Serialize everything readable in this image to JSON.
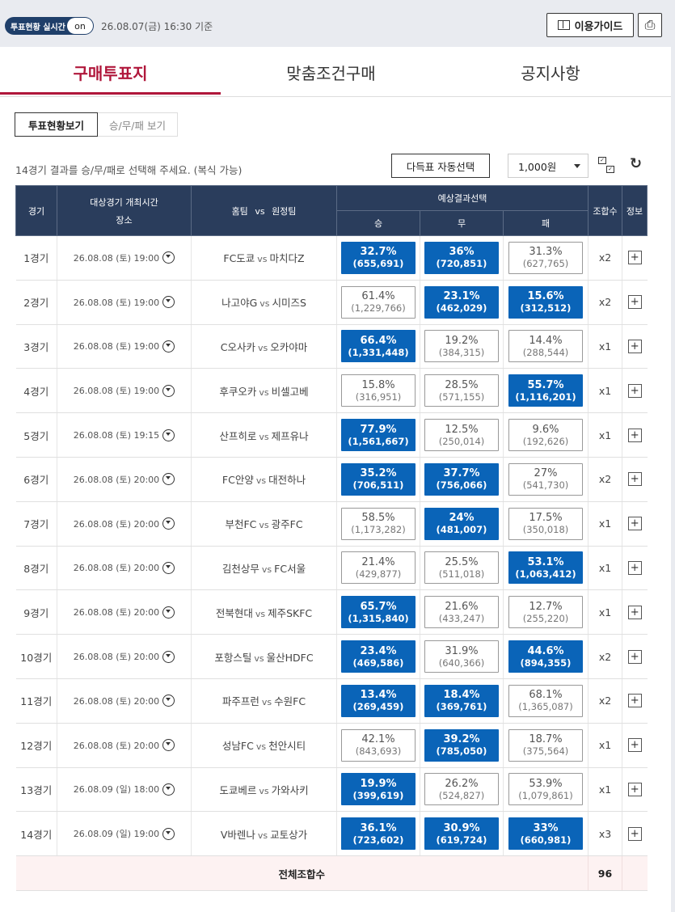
{
  "topbar": {
    "live_label": "투표현황 실시간",
    "live_toggle": "on",
    "timestamp": "26.08.07(금) 16:30 기준",
    "guide_label": "이용가이드"
  },
  "main_tabs": [
    {
      "label": "구매투표지",
      "active": true
    },
    {
      "label": "맞춤조건구매",
      "active": false
    },
    {
      "label": "공지사항",
      "active": false
    }
  ],
  "sub_tabs": [
    {
      "label": "투표현황보기",
      "active": true
    },
    {
      "label": "승/무/패 보기",
      "active": false
    }
  ],
  "toolbar": {
    "instruction": "14경기 결과를 승/무/패로 선택해 주세요. (복식 가능)",
    "auto_select_label": "다득표 자동선택",
    "amount_value": "1,000원"
  },
  "table": {
    "headers": {
      "game": "경기",
      "time_line1": "대상경기 개최시간",
      "time_line2": "장소",
      "teams_home": "홈팀",
      "teams_vs": "vs",
      "teams_away": "원정팀",
      "prediction": "예상결과선택",
      "win": "승",
      "draw": "무",
      "loss": "패",
      "combo": "조합수",
      "info": "정보"
    },
    "rows": [
      {
        "game": "1경기",
        "datetime": "26.08.08 (토) 19:00",
        "home": "FC도쿄",
        "away": "마치다Z",
        "win": {
          "pct": "32.7%",
          "count": "(655,691)",
          "selected": true
        },
        "draw": {
          "pct": "36%",
          "count": "(720,851)",
          "selected": true
        },
        "loss": {
          "pct": "31.3%",
          "count": "(627,765)",
          "selected": false
        },
        "combo": "x2"
      },
      {
        "game": "2경기",
        "datetime": "26.08.08 (토) 19:00",
        "home": "나고야G",
        "away": "시미즈S",
        "win": {
          "pct": "61.4%",
          "count": "(1,229,766)",
          "selected": false
        },
        "draw": {
          "pct": "23.1%",
          "count": "(462,029)",
          "selected": true
        },
        "loss": {
          "pct": "15.6%",
          "count": "(312,512)",
          "selected": true
        },
        "combo": "x2"
      },
      {
        "game": "3경기",
        "datetime": "26.08.08 (토) 19:00",
        "home": "C오사카",
        "away": "오카야마",
        "win": {
          "pct": "66.4%",
          "count": "(1,331,448)",
          "selected": true
        },
        "draw": {
          "pct": "19.2%",
          "count": "(384,315)",
          "selected": false
        },
        "loss": {
          "pct": "14.4%",
          "count": "(288,544)",
          "selected": false
        },
        "combo": "x1"
      },
      {
        "game": "4경기",
        "datetime": "26.08.08 (토) 19:00",
        "home": "후쿠오카",
        "away": "비셀고베",
        "win": {
          "pct": "15.8%",
          "count": "(316,951)",
          "selected": false
        },
        "draw": {
          "pct": "28.5%",
          "count": "(571,155)",
          "selected": false
        },
        "loss": {
          "pct": "55.7%",
          "count": "(1,116,201)",
          "selected": true
        },
        "combo": "x1"
      },
      {
        "game": "5경기",
        "datetime": "26.08.08 (토) 19:15",
        "home": "산프히로",
        "away": "제프유나",
        "win": {
          "pct": "77.9%",
          "count": "(1,561,667)",
          "selected": true
        },
        "draw": {
          "pct": "12.5%",
          "count": "(250,014)",
          "selected": false
        },
        "loss": {
          "pct": "9.6%",
          "count": "(192,626)",
          "selected": false
        },
        "combo": "x1"
      },
      {
        "game": "6경기",
        "datetime": "26.08.08 (토) 20:00",
        "home": "FC안양",
        "away": "대전하나",
        "win": {
          "pct": "35.2%",
          "count": "(706,511)",
          "selected": true
        },
        "draw": {
          "pct": "37.7%",
          "count": "(756,066)",
          "selected": true
        },
        "loss": {
          "pct": "27%",
          "count": "(541,730)",
          "selected": false
        },
        "combo": "x2"
      },
      {
        "game": "7경기",
        "datetime": "26.08.08 (토) 20:00",
        "home": "부천FC",
        "away": "광주FC",
        "win": {
          "pct": "58.5%",
          "count": "(1,173,282)",
          "selected": false
        },
        "draw": {
          "pct": "24%",
          "count": "(481,007)",
          "selected": true
        },
        "loss": {
          "pct": "17.5%",
          "count": "(350,018)",
          "selected": false
        },
        "combo": "x1"
      },
      {
        "game": "8경기",
        "datetime": "26.08.08 (토) 20:00",
        "home": "김천상무",
        "away": "FC서울",
        "win": {
          "pct": "21.4%",
          "count": "(429,877)",
          "selected": false
        },
        "draw": {
          "pct": "25.5%",
          "count": "(511,018)",
          "selected": false
        },
        "loss": {
          "pct": "53.1%",
          "count": "(1,063,412)",
          "selected": true
        },
        "combo": "x1"
      },
      {
        "game": "9경기",
        "datetime": "26.08.08 (토) 20:00",
        "home": "전북현대",
        "away": "제주SKFC",
        "win": {
          "pct": "65.7%",
          "count": "(1,315,840)",
          "selected": true
        },
        "draw": {
          "pct": "21.6%",
          "count": "(433,247)",
          "selected": false
        },
        "loss": {
          "pct": "12.7%",
          "count": "(255,220)",
          "selected": false
        },
        "combo": "x1"
      },
      {
        "game": "10경기",
        "datetime": "26.08.08 (토) 20:00",
        "home": "포항스틸",
        "away": "울산HDFC",
        "win": {
          "pct": "23.4%",
          "count": "(469,586)",
          "selected": true
        },
        "draw": {
          "pct": "31.9%",
          "count": "(640,366)",
          "selected": false
        },
        "loss": {
          "pct": "44.6%",
          "count": "(894,355)",
          "selected": true
        },
        "combo": "x2"
      },
      {
        "game": "11경기",
        "datetime": "26.08.08 (토) 20:00",
        "home": "파주프런",
        "away": "수원FC",
        "win": {
          "pct": "13.4%",
          "count": "(269,459)",
          "selected": true
        },
        "draw": {
          "pct": "18.4%",
          "count": "(369,761)",
          "selected": true
        },
        "loss": {
          "pct": "68.1%",
          "count": "(1,365,087)",
          "selected": false
        },
        "combo": "x2"
      },
      {
        "game": "12경기",
        "datetime": "26.08.08 (토) 20:00",
        "home": "성남FC",
        "away": "천안시티",
        "win": {
          "pct": "42.1%",
          "count": "(843,693)",
          "selected": false
        },
        "draw": {
          "pct": "39.2%",
          "count": "(785,050)",
          "selected": true
        },
        "loss": {
          "pct": "18.7%",
          "count": "(375,564)",
          "selected": false
        },
        "combo": "x1"
      },
      {
        "game": "13경기",
        "datetime": "26.08.09 (일) 18:00",
        "home": "도쿄베르",
        "away": "가와사키",
        "win": {
          "pct": "19.9%",
          "count": "(399,619)",
          "selected": true
        },
        "draw": {
          "pct": "26.2%",
          "count": "(524,827)",
          "selected": false
        },
        "loss": {
          "pct": "53.9%",
          "count": "(1,079,861)",
          "selected": false
        },
        "combo": "x1"
      },
      {
        "game": "14경기",
        "datetime": "26.08.09 (일) 19:00",
        "home": "V바렌나",
        "away": "교토상가",
        "win": {
          "pct": "36.1%",
          "count": "(723,602)",
          "selected": true
        },
        "draw": {
          "pct": "30.9%",
          "count": "(619,724)",
          "selected": true
        },
        "loss": {
          "pct": "33%",
          "count": "(660,981)",
          "selected": true
        },
        "combo": "x3"
      }
    ],
    "total_label": "전체조합수",
    "total_value": "96"
  },
  "colors": {
    "accent": "#b0173b",
    "header_bg": "#2a3d5c",
    "selected_bg": "#0a64b8",
    "total_bg": "#fdf2f2"
  },
  "icons": [
    "book-icon",
    "printer-icon",
    "location-pin-icon",
    "caret-down-icon",
    "checkbox-toggle-icon",
    "refresh-icon",
    "plus-icon"
  ]
}
